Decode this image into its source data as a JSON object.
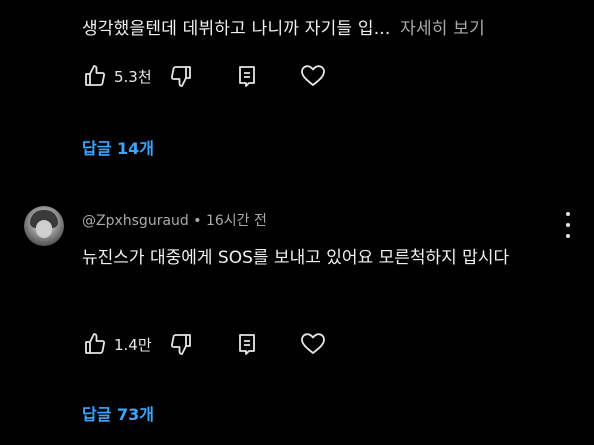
{
  "previous_comment": {
    "snippet": "생각했을텐데 데뷔하고 나니까 자기들 입...",
    "read_more_label": "자세히 보기",
    "like_count": "5.3천",
    "replies_label": "답글 14개"
  },
  "comment": {
    "author": "@Zpxhsguraud",
    "separator": "•",
    "time": "16시간 전",
    "text": "뉴진스가 대중에게 SOS를 보내고 있어요 모른척하지 맙시다",
    "like_count": "1.4만",
    "replies_label": "답글 73개"
  },
  "colors": {
    "background": "#000000",
    "text": "#f1f1f1",
    "secondary_text": "#aaaaaa",
    "link": "#3ea6ff"
  },
  "icons": [
    "thumbs-up-icon",
    "thumbs-down-icon",
    "reply-icon",
    "heart-icon",
    "more-vert-icon"
  ]
}
